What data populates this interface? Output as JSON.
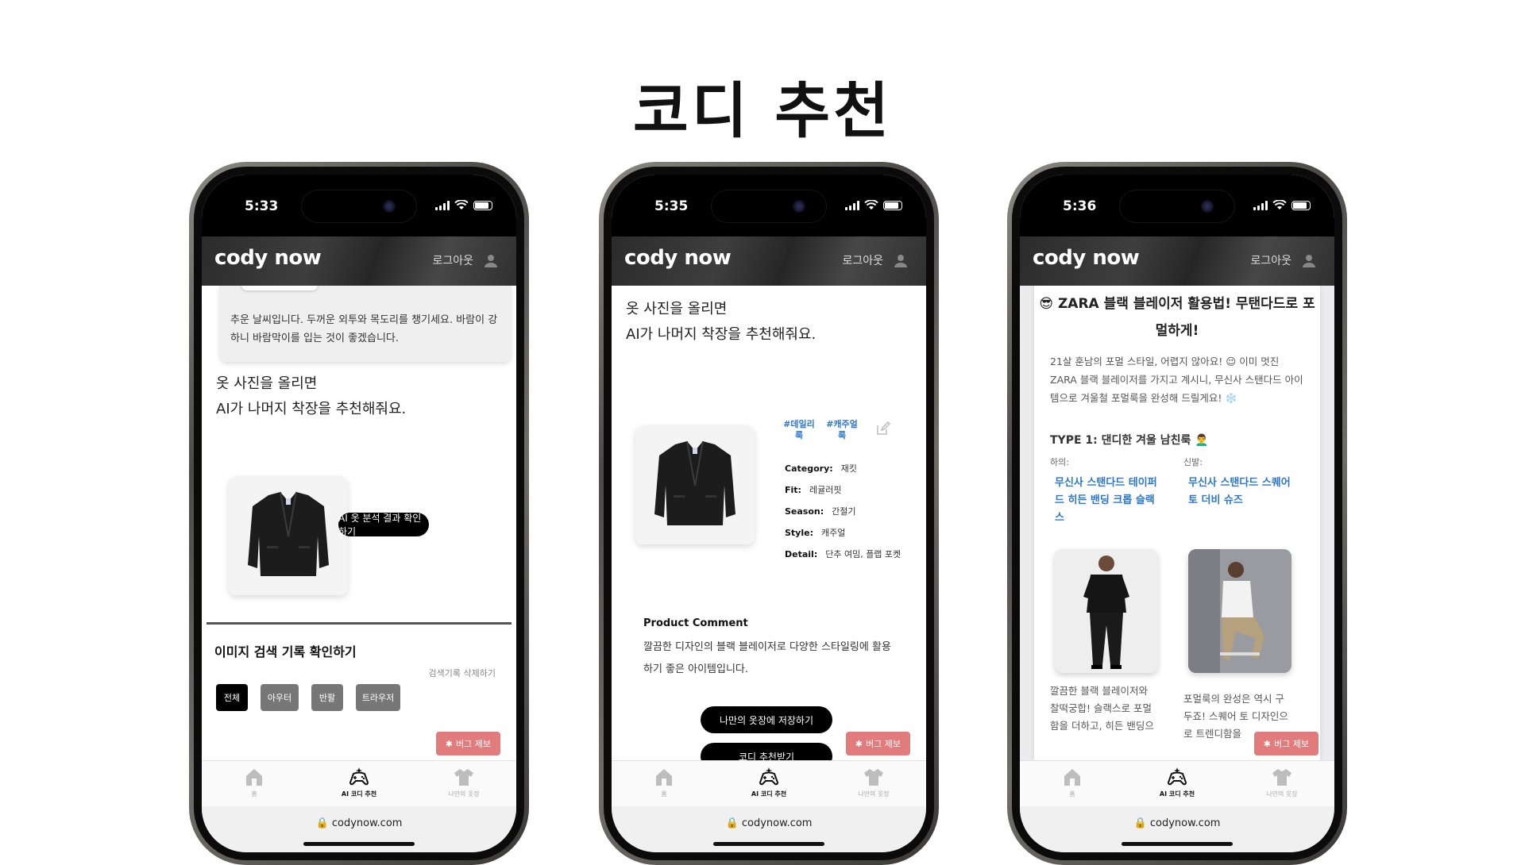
{
  "page": {
    "title": "코디 추천"
  },
  "common": {
    "logo": "cody now",
    "logout": "로그아웃",
    "url": "codynow.com",
    "bug_report": "버그 제보",
    "tabs": [
      {
        "label": "홈",
        "icon": "home-icon"
      },
      {
        "label": "AI 코디 추천",
        "icon": "gamepad-icon"
      },
      {
        "label": "나만의 옷장",
        "icon": "shirt-icon"
      }
    ]
  },
  "phone1": {
    "time": "5:33",
    "weather_text": "추운 날씨입니다. 두꺼운 외투와 목도리를 챙기세요. 바람이 강하니 바람막이를 입는 것이 좋겠습니다.",
    "headline_line1": "옷 사진을 올리면",
    "headline_line2": "AI가 나머지 착장을 추천해줘요.",
    "analyze_button": "AI 옷 분석 결과 확인하기",
    "history_title": "이미지 검색 기록 확인하기",
    "clear_history": "검색기록 삭제하기",
    "filters": [
      "전체",
      "아우터",
      "반팔",
      "트라우저"
    ],
    "active_filter": "전체"
  },
  "phone2": {
    "time": "5:35",
    "headline_line1": "옷 사진을 올리면",
    "headline_line2": "AI가 나머지 착장을 추천해줘요.",
    "tags": [
      "#데일리룩",
      "#캐주얼룩"
    ],
    "attributes": [
      {
        "key": "Category:",
        "value": "재킷"
      },
      {
        "key": "Fit:",
        "value": "레귤러핏"
      },
      {
        "key": "Season:",
        "value": "간절기"
      },
      {
        "key": "Style:",
        "value": "캐주얼"
      },
      {
        "key": "Detail:",
        "value": "단추 여밈, 플랩 포켓"
      }
    ],
    "comment_title": "Product Comment",
    "comment_text": "깔끔한 디자인의 블랙 블레이저로 다양한 스타일링에 활용하기 좋은 아이템입니다.",
    "save_button": "나만의 옷장에 저장하기",
    "recommend_button": "코디 추천받기"
  },
  "phone3": {
    "time": "5:36",
    "title": "😎 ZARA 블랙 블레이저 활용법! 무탠다드로 포멀하게!",
    "intro": "21살 훈남의 포멀 스타일, 어렵지 않아요! 😉 이미 멋진 ZARA 블랙 블레이저를 가지고 계시니, 무신사 스탠다드 아이템으로 겨울철 포멀룩을 완성해 드릴게요! ❄️",
    "type_title": "TYPE 1: 댄디한 겨울 남친룩 👨‍🦱",
    "bottom_label": "하의:",
    "shoes_label": "신발:",
    "bottom_product": "무신사 스탠다드 테이퍼드 히든 밴딩 크롭 슬랙스",
    "shoes_product": "무신사 스탠다드 스퀘어 토 더비 슈즈",
    "bottom_desc": "깔끔한 블랙 블레이저와 찰떡궁합! 슬랙스로 포멀함을 더하고, 히든 밴딩으로 편안함까지 잡았",
    "shoes_desc": "포멀룩의 완성은 역시 구두죠! 스퀘어 토 디자인으로 트렌디함을"
  }
}
